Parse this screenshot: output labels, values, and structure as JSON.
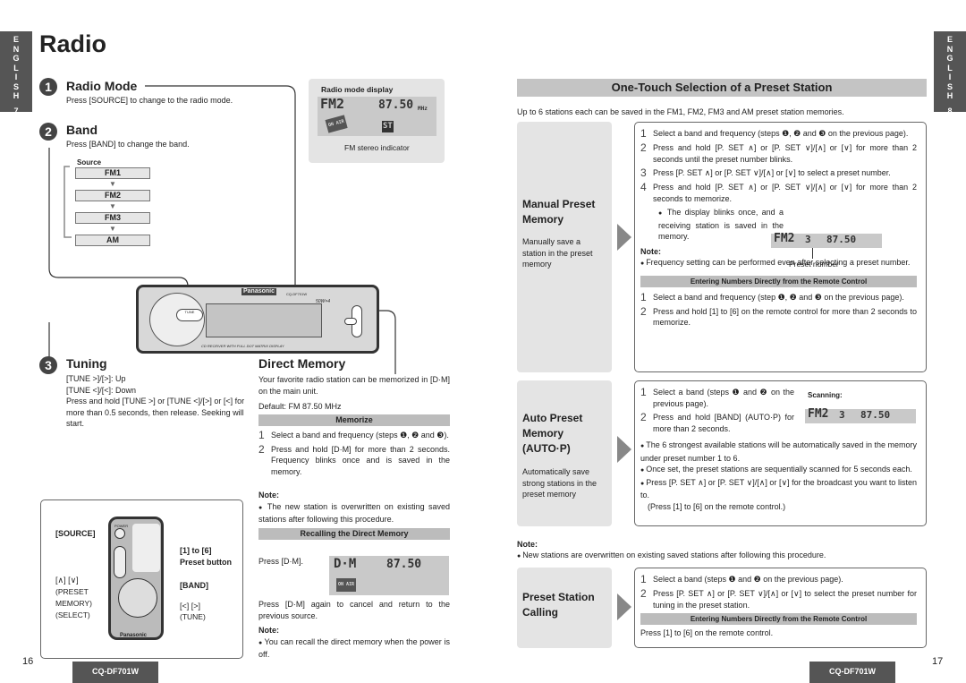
{
  "side_tab_left": {
    "letters": [
      "E",
      "N",
      "G",
      "L",
      "I",
      "S",
      "H"
    ],
    "page": "7"
  },
  "side_tab_right": {
    "letters": [
      "E",
      "N",
      "G",
      "L",
      "I",
      "S",
      "H"
    ],
    "page": "8"
  },
  "title": "Radio",
  "radio_mode": {
    "num": "1",
    "title": "Radio Mode",
    "text": "Press [SOURCE] to change to the radio mode."
  },
  "display": {
    "title": "Radio mode display",
    "band": "FM2",
    "freq": "87.50",
    "unit": "MHz",
    "badge": "ON AIR",
    "st": "ST",
    "caption": "FM stereo indicator"
  },
  "band": {
    "num": "2",
    "title": "Band",
    "text": "Press [BAND] to change the band.",
    "source_label": "Source",
    "sources": [
      "FM1",
      "FM2",
      "FM3",
      "AM"
    ]
  },
  "unit": {
    "brand": "Panasonic",
    "model": "CQ-DF701W",
    "power": "50W×4",
    "caption": "CD RECEIVER WITH FULL DOT MATRIX DISPLAY"
  },
  "tuning": {
    "num": "3",
    "title": "Tuning",
    "lines": [
      "[TUNE >]/[>]: Up",
      "[TUNE <]/[<]: Down",
      "Press and hold [TUNE >] or [TUNE <]/[>] or [<] for more than 0.5 seconds, then release. Seeking will start."
    ]
  },
  "remote": {
    "source": "[SOURCE]",
    "preset_range": "[1] to [6]",
    "preset_label": "Preset button",
    "updown": "[∧] [∨]",
    "preset_mem": "(PRESET MEMORY)",
    "select": "(SELECT)",
    "band": "[BAND]",
    "lr": "[<] [>]",
    "tune": "(TUNE)",
    "brand": "Panasonic",
    "power": "POWER"
  },
  "direct_memory": {
    "title": "Direct Memory",
    "intro": "Your favorite radio station can be memorized in [D·M] on the main unit.",
    "default": "Default: FM 87.50 MHz",
    "memorize_bar": "Memorize",
    "steps": [
      "Select a band and frequency (steps ❶, ❷ and ❸).",
      "Press and hold [D·M] for more than 2 seconds. Frequency blinks once and is saved in the memory."
    ],
    "note_label": "Note:",
    "note": "The new station is overwritten on existing saved stations after following this procedure.",
    "recall_bar": "Recalling the Direct Memory",
    "recall_text": "Press [D·M].",
    "lcd_band": "D·M",
    "lcd_freq": "87.50",
    "recall_again": "Press [D·M] again to cancel and return to the previous source.",
    "note2_label": "Note:",
    "note2": "You can recall the direct memory when the power is off."
  },
  "page_left": "16",
  "page_right": "17",
  "model_footer": "CQ-DF701W",
  "one_touch": {
    "title": "One-Touch Selection of a Preset Station",
    "intro": "Up to 6 stations each can be saved in the FM1, FM2, FM3 and AM preset station memories."
  },
  "manual": {
    "title": "Manual Preset Memory",
    "desc": "Manually save a station in the preset memory",
    "steps": [
      "Select a band and frequency (steps ❶, ❷ and ❸ on the previous page).",
      "Press and hold [P. SET ∧] or [P. SET ∨]/[∧] or [∨] for more than 2 seconds until the preset number blinks.",
      "Press [P. SET ∧] or [P. SET ∨]/[∧] or [∨] to select a preset number.",
      "Press and hold [P. SET ∧] or [P. SET ∨]/[∧] or [∨] for more than 2 seconds to memorize."
    ],
    "bullet": "The display blinks once, and a receiving station is saved in the memory.",
    "lcd_band": "FM2",
    "lcd_preset": "3",
    "lcd_freq": "87.50",
    "preset_caption": "Preset number",
    "note_label": "Note:",
    "note": "Frequency setting can be performed even after selecting a preset number.",
    "bar": "Entering Numbers Directly from the Remote Control",
    "remote_steps": [
      "Select a band and frequency (step ❶, ❷ and ❸ on the previous page).",
      "Press and hold [1] to [6] on the remote control for more than 2 seconds to memorize."
    ]
  },
  "auto": {
    "title": "Auto Preset Memory (AUTO·P)",
    "desc": "Automatically save strong stations in the preset memory",
    "steps": [
      "Select a band (steps ❶ and ❷ on the previous page).",
      "Press and hold [BAND] (AUTO·P) for more than 2 seconds."
    ],
    "scanning": "Scanning:",
    "bullets": [
      "The 6 strongest available stations will be automatically saved in the memory under preset number 1 to 6.",
      "Once set, the preset stations are sequentially scanned for 5 seconds each.",
      "Press [P. SET ∧] or [P. SET ∨]/[∧] or [∨] for the broadcast you want to listen to."
    ],
    "sub": "(Press [1] to [6] on the remote control.)"
  },
  "note_mid": {
    "label": "Note:",
    "text": "New stations are overwritten on existing saved stations after following this procedure."
  },
  "calling": {
    "title": "Preset Station Calling",
    "steps": [
      "Select a band (steps ❶ and ❷ on the previous page).",
      "Press [P. SET ∧] or [P. SET ∨]/[∧] or [∨] to select the preset number for tuning in the preset station."
    ],
    "bar": "Entering Numbers Directly from the Remote Control",
    "text": "Press [1] to [6] on the remote control."
  }
}
